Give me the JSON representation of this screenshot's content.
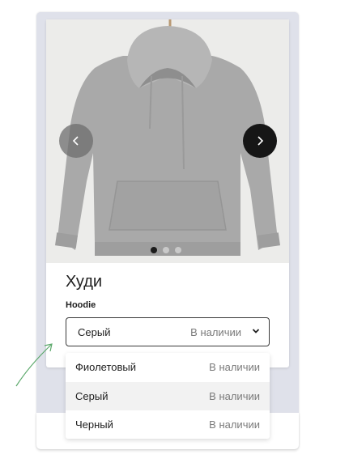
{
  "product": {
    "title": "Худи",
    "subtitle": "Hoodie",
    "image_icon": "hoodie-on-hanger-photo",
    "carousel": {
      "slide_count": 3,
      "active_index": 0
    }
  },
  "select": {
    "value": "Серый",
    "status": "В наличии"
  },
  "options": [
    {
      "label": "Фиолетовый",
      "status": "В наличии"
    },
    {
      "label": "Серый",
      "status": "В наличии"
    },
    {
      "label": "Черный",
      "status": "В наличии"
    }
  ],
  "colors": {
    "accent_arrow": "#5aa86a",
    "card_bg": "#dfe1ea",
    "highlight": "#f2f2f2"
  }
}
